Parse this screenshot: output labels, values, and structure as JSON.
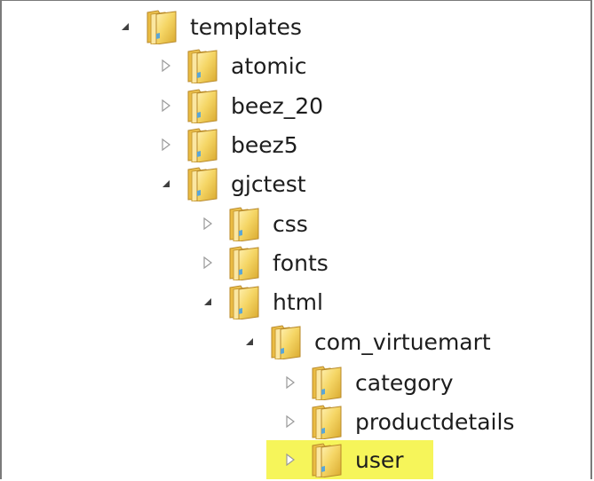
{
  "tree": {
    "items": [
      {
        "label": "templates",
        "expanded": true
      },
      {
        "label": "atomic",
        "expanded": false
      },
      {
        "label": "beez_20",
        "expanded": false
      },
      {
        "label": "beez5",
        "expanded": false
      },
      {
        "label": "gjctest",
        "expanded": true
      },
      {
        "label": "css",
        "expanded": false
      },
      {
        "label": "fonts",
        "expanded": false
      },
      {
        "label": "html",
        "expanded": true
      },
      {
        "label": "com_virtuemart",
        "expanded": true
      },
      {
        "label": "category",
        "expanded": false
      },
      {
        "label": "productdetails",
        "expanded": false
      },
      {
        "label": "user",
        "expanded": false,
        "highlighted": true
      }
    ]
  },
  "colors": {
    "highlight": "#f6f55a",
    "folder": "#f2cf5b",
    "text": "#1d1d1d"
  }
}
